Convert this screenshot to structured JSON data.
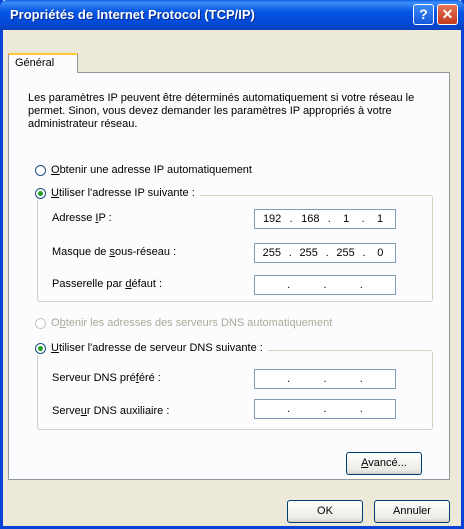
{
  "window": {
    "title": "Propriétés de Internet Protocol (TCP/IP)",
    "help_glyph": "?",
    "close_glyph": "✕"
  },
  "tabs": [
    {
      "label": "Général"
    }
  ],
  "intro_text": "Les paramètres IP peuvent être déterminés automatiquement si votre réseau le permet. Sinon, vous devez demander les paramètres IP appropriés à votre administrateur réseau.",
  "ip": {
    "auto_label_prefix": "",
    "auto_label_key": "O",
    "auto_label_rest": "btenir une adresse IP automatiquement",
    "auto_selected": false,
    "manual_label_key": "U",
    "manual_label_rest": "tiliser l'adresse IP suivante :",
    "manual_selected": true,
    "fields": [
      {
        "label_pre": "Adresse ",
        "label_key": "I",
        "label_post": "P :",
        "octets": [
          "192",
          "168",
          "1",
          "1"
        ]
      },
      {
        "label_pre": "Masque de ",
        "label_key": "s",
        "label_post": "ous-réseau :",
        "octets": [
          "255",
          "255",
          "255",
          "0"
        ]
      },
      {
        "label_pre": "Passerelle par ",
        "label_key": "d",
        "label_post": "éfaut :",
        "octets": [
          "",
          "",
          "",
          ""
        ]
      }
    ]
  },
  "dns": {
    "auto_label_pre": "O",
    "auto_label_key": "b",
    "auto_label_rest": "tenir les adresses des serveurs DNS automatiquement",
    "auto_selected": false,
    "auto_disabled": true,
    "manual_label_key": "U",
    "manual_label_rest": "tiliser l'adresse de serveur DNS suivante :",
    "manual_selected": true,
    "fields": [
      {
        "label_pre": "Serveur DNS pré",
        "label_key": "f",
        "label_post": "éré :",
        "octets": [
          "",
          "",
          "",
          ""
        ]
      },
      {
        "label_pre": "Serve",
        "label_key": "u",
        "label_post": "r DNS auxiliaire :",
        "octets": [
          "",
          "",
          "",
          ""
        ]
      }
    ]
  },
  "buttons": {
    "advanced_key": "A",
    "advanced_rest": "vancé...",
    "ok": "OK",
    "cancel": "Annuler"
  }
}
